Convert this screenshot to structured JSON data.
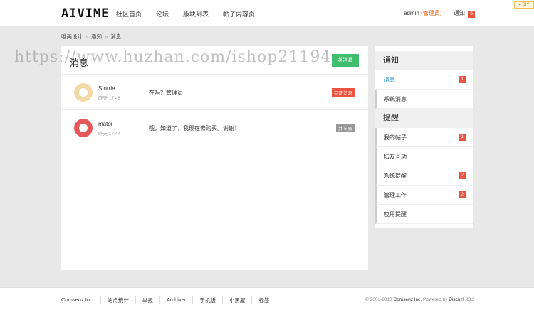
{
  "header": {
    "logo": "AIVIME",
    "nav": [
      "社区首页",
      "论坛",
      "版块列表",
      "帖子内容页"
    ],
    "user": "admin",
    "role": "管理员",
    "notice_label": "通知",
    "notice_count": "5",
    "diy": "DIY"
  },
  "breadcrumb": [
    "唯美设计",
    "通知",
    "消息"
  ],
  "main": {
    "title": "消息",
    "send_button": "发消息",
    "watermark": "https://www.huzhan.com/ishop21194"
  },
  "messages": [
    {
      "name": "Storrie",
      "time": "昨天 17:45",
      "text": "在吗？管理员",
      "tag": "有新消息"
    },
    {
      "name": "matoi",
      "time": "昨天 17:44",
      "text": "哦，知道了，我现在去购买。谢谢！",
      "tag": "共 5 条"
    }
  ],
  "sidebar": {
    "section1": "通知",
    "items1": [
      {
        "label": "消息",
        "badge": "1"
      },
      {
        "label": "系统消息",
        "badge": ""
      }
    ],
    "section2": "提醒",
    "items2": [
      {
        "label": "我的帖子",
        "badge": "1"
      },
      {
        "label": "坛友互动",
        "badge": ""
      },
      {
        "label": "系统提醒",
        "badge": "2"
      },
      {
        "label": "管理工作",
        "badge": "2"
      },
      {
        "label": "应用提醒",
        "badge": ""
      }
    ]
  },
  "footer": {
    "links": [
      "Comsenz Inc.",
      "站点统计",
      "举报",
      "Archiver",
      "手机版",
      "小黑屋",
      "标签"
    ],
    "copy_prefix": "© 2001-2013 ",
    "copy_company": "Comsenz Inc.",
    "copy_powered": " Powered by ",
    "copy_product": "Discuz!",
    "copy_version": " X3.2"
  },
  "colors": {
    "accent": "#3fbf6e",
    "badge": "#e9533f",
    "active": "#2d8ad8"
  }
}
